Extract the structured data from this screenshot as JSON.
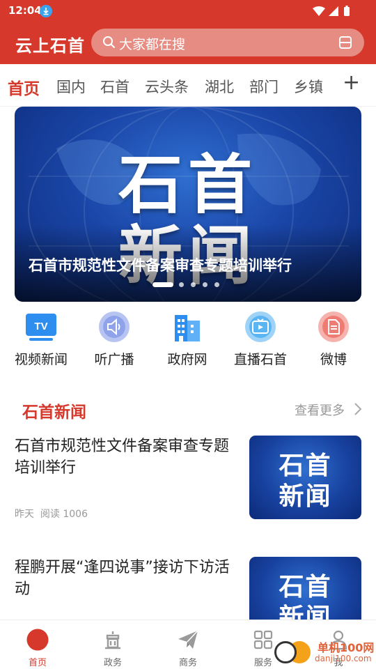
{
  "status_bar": {
    "time": "12:04"
  },
  "header": {
    "app_title": "云上石首",
    "search_placeholder": "大家都在搜",
    "brand_color": "#d6392b"
  },
  "tabs": [
    {
      "label": "首页",
      "active": true
    },
    {
      "label": "国内"
    },
    {
      "label": "石首"
    },
    {
      "label": "云头条"
    },
    {
      "label": "湖北"
    },
    {
      "label": "部门"
    },
    {
      "label": "乡镇"
    }
  ],
  "tab_add_label": "+",
  "banner": {
    "image_text_line1": "石首",
    "image_text_line2": "新闻",
    "caption": "石首市规范性文件备案审查专题培训举行",
    "slide_count": 5,
    "active_slide": 1
  },
  "quick_entries": [
    {
      "label": "视频新闻",
      "icon": "tv-icon"
    },
    {
      "label": "听广播",
      "icon": "broadcast-icon"
    },
    {
      "label": "政府网",
      "icon": "building-icon"
    },
    {
      "label": "直播石首",
      "icon": "live-video-icon"
    },
    {
      "label": "微博",
      "icon": "document-icon"
    }
  ],
  "section": {
    "title": "石首新闻",
    "more_label": "查看更多"
  },
  "news": [
    {
      "title": "石首市规范性文件备案审查专题培训举行",
      "time": "昨天",
      "reads": "阅读 1006",
      "thumb_line1": "石首",
      "thumb_line2": "新闻"
    },
    {
      "title": "程鹏开展“逢四说事”接访下访活动",
      "thumb_line1": "石首",
      "thumb_line2": "新闻"
    }
  ],
  "bottom_nav": [
    {
      "label": "首页",
      "icon": "home-dot-icon",
      "active": true
    },
    {
      "label": "政务",
      "icon": "government-icon"
    },
    {
      "label": "商务",
      "icon": "paper-plane-icon"
    },
    {
      "label": "服务",
      "icon": "grid-icon"
    },
    {
      "label": "我",
      "icon": "user-icon"
    }
  ],
  "watermark": {
    "text": "单机100网",
    "url": "danji100.com"
  }
}
